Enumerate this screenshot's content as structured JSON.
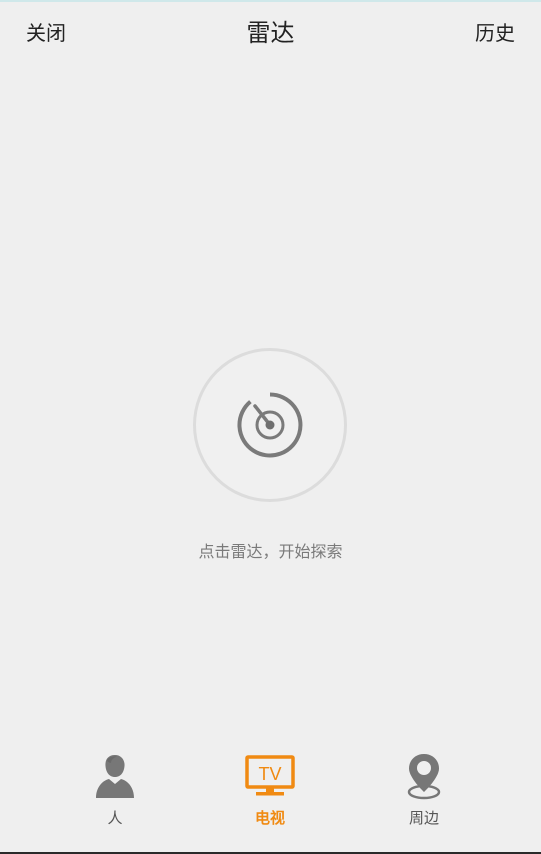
{
  "header": {
    "close_label": "关闭",
    "title": "雷达",
    "history_label": "历史"
  },
  "radar": {
    "hint": "点击雷达，开始探索"
  },
  "tabs": [
    {
      "label": "人",
      "icon": "person-icon",
      "active": false
    },
    {
      "label": "电视",
      "icon": "tv-icon",
      "active": true
    },
    {
      "label": "周边",
      "icon": "location-pin-icon",
      "active": false
    }
  ],
  "colors": {
    "accent": "#f08a12",
    "background": "#efefef",
    "text": "#222222",
    "muted": "#7a7a7a",
    "icon_gray": "#777777"
  }
}
